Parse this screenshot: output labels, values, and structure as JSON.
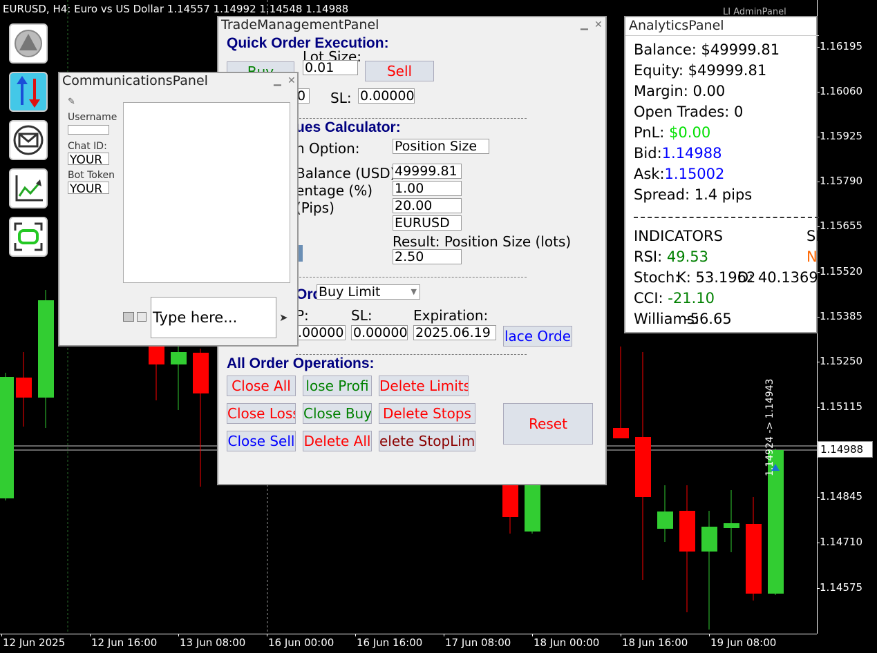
{
  "chart": {
    "header": "EURUSD, H4:  Euro vs US Dollar  1.14557 1.14992 1.14548 1.14988",
    "brand": "LI AdminPanel",
    "price_ticks": [
      "1.16195",
      "1.16060",
      "1.15925",
      "1.15790",
      "1.15655",
      "1.15520",
      "1.15385",
      "1.15250",
      "1.15115",
      "1.14988",
      "1.14845",
      "1.14710",
      "1.14575"
    ],
    "bid_label": "1.14988",
    "trade_label": "1.14924 -> 1.14943",
    "time_ticks": [
      "12 Jun 2025",
      "12 Jun 16:00",
      "13 Jun 08:00",
      "16 Jun 00:00",
      "16 Jun 16:00",
      "17 Jun 08:00",
      "18 Jun 00:00",
      "18 Jun 16:00",
      "19 Jun 08:00"
    ]
  },
  "tools": [
    {
      "name": "home-icon"
    },
    {
      "name": "trade-arrows-icon"
    },
    {
      "name": "envelope-icon"
    },
    {
      "name": "analytics-chart-icon"
    },
    {
      "name": "fullscreen-icon"
    }
  ],
  "comm": {
    "title": "CommunicationsPanel",
    "username_label": "Username",
    "chat_id_label": "Chat ID:",
    "chat_id_value": "YOUR",
    "bot_token_label": "Bot Token",
    "bot_token_value": "YOUR",
    "message_placeholder": "Type here..."
  },
  "trade": {
    "title": "TradeManagementPanel",
    "quick_header": "Quick Order Execution:",
    "lot_size_label": "Lot Size:",
    "buy_label": "Buy",
    "lot_size_value": "0.01",
    "sell_label": "Sell",
    "tp_value_partial": "0",
    "sl_label": "SL:",
    "sl_value": "0.00000",
    "calc_header": "ues Calculator:",
    "option_label": "n Option:",
    "option_value": "Position Size",
    "balance_label": "Balance (USD)",
    "balance_value": "49999.81",
    "percentage_label": "entage (%)",
    "percentage_value": "1.00",
    "pips_label": "(Pips)",
    "pips_value": "20.00",
    "symbol_value": "EURUSD",
    "result_label": "Result: Position Size (lots)",
    "result_value": "2.50",
    "pending_header": "Orders",
    "order_type": "Buy Limit",
    "tp_label_partial": "P:",
    "pending_sl_label": "SL:",
    "expiration_label": "Expiration:",
    "pending_tp_value": ".00000",
    "pending_sl_value": "0.00000",
    "expiration_value": "2025.06.19",
    "place_order_label": "lace Orde",
    "all_ops_header": "All Order Operations:",
    "close_all": "Close All",
    "close_profit": "lose Profi",
    "delete_limits": "Delete Limits",
    "close_loss": "Close Loss",
    "close_buy": "Close Buy",
    "delete_stops": "Delete Stops",
    "close_sell": "Close Sell",
    "delete_all": "Delete All",
    "delete_stoplimit": "elete StopLimi",
    "reset": "Reset"
  },
  "analytics": {
    "title": "AnalyticsPanel",
    "balance": "Balance: $49999.81",
    "equity": "Equity: $49999.81",
    "margin": "Margin: 0.00",
    "open_trades": "Open Trades: 0",
    "pnl_label": "PnL: ",
    "pnl_value": "$0.00",
    "bid_label": "Bid:",
    "bid_value": "1.14988",
    "ask_label": "Ask:",
    "ask_value": "1.15002",
    "spread": "Spread: 1.4 pips",
    "indicators_label": "INDICATORS",
    "signal_partial": "SI",
    "signal_value_partial": "N",
    "rsi_label": "RSI:",
    "rsi_value": "49.53",
    "stoch_label": "Stoch:",
    "stoch_k": "K: 53.1962",
    "stoch_d": "D: 40.1369",
    "cci_label": "CCI:",
    "cci_value": "-21.10",
    "williams_label": "Williams:",
    "williams_value": "-56.65"
  },
  "colors": {
    "bull": "#32cd32",
    "bear": "#ff0000",
    "panel_bg": "#f0f0f0",
    "header_blue": "#000080",
    "active_tool": "#43c8e8"
  }
}
